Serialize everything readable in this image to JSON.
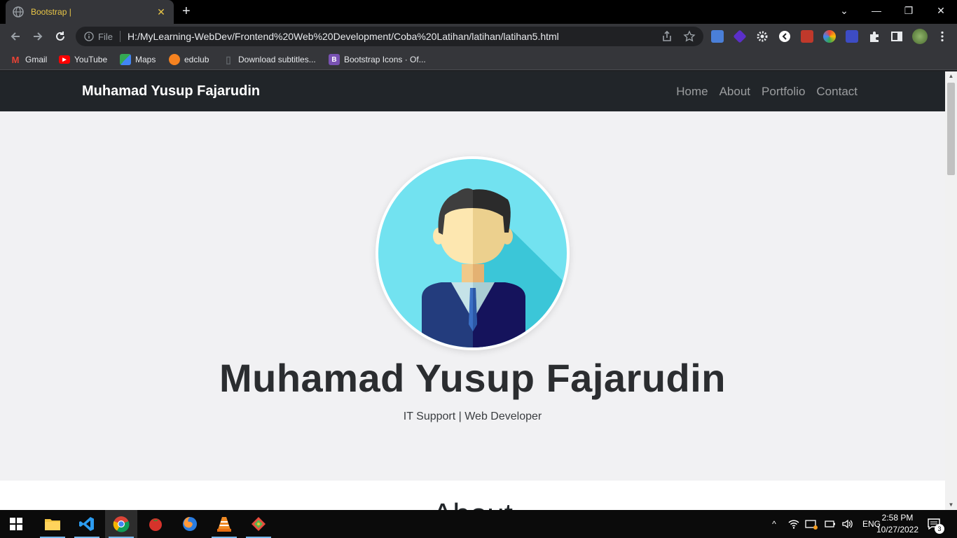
{
  "browser": {
    "tab_title": "Bootstrap |",
    "tab_close": "✕",
    "new_tab": "+",
    "info_label": "File",
    "url": "H:/MyLearning-WebDev/Frontend%20Web%20Development/Coba%20Latihan/latihan/latihan5.html",
    "bookmarks": [
      {
        "label": "Gmail",
        "icon": "gmail-icon",
        "color": "#ea4335"
      },
      {
        "label": "YouTube",
        "icon": "youtube-icon",
        "color": "#ff0000"
      },
      {
        "label": "Maps",
        "icon": "maps-icon",
        "color": "#34a853"
      },
      {
        "label": "edclub",
        "icon": "edclub-icon",
        "color": "#f58220"
      },
      {
        "label": "Download subtitles...",
        "icon": "subtitles-icon",
        "color": "#5f6368"
      },
      {
        "label": "Bootstrap Icons · Of...",
        "icon": "bootstrap-icon",
        "color": "#7952b3"
      }
    ]
  },
  "page": {
    "brand": "Muhamad Yusup Fajarudin",
    "nav": [
      "Home",
      "About",
      "Portfolio",
      "Contact"
    ],
    "hero_name": "Muhamad Yusup Fajarudin",
    "hero_subtitle": "IT Support | Web Developer",
    "about_title": "About"
  },
  "taskbar": {
    "language": "ENG",
    "time": "2:58 PM",
    "date": "10/27/2022",
    "notifications": "3"
  },
  "colors": {
    "navbar": "#212529",
    "hero_bg": "#f1f1f3",
    "avatar_bg": "#72e2f0",
    "tab_accent": "#e8c547"
  }
}
